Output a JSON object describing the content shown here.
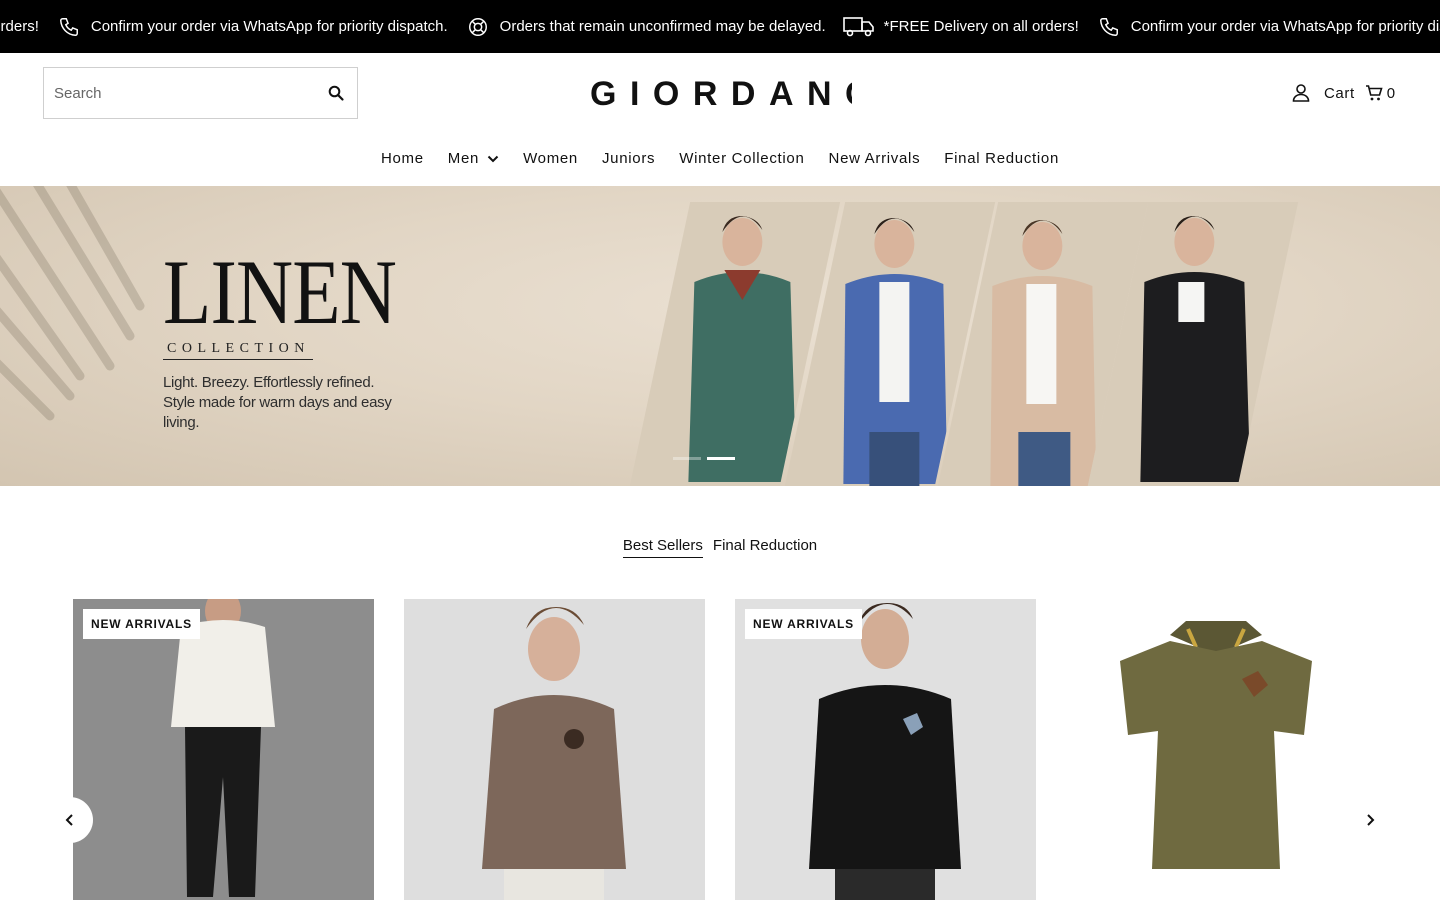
{
  "announcement": {
    "items": [
      {
        "icon": "truck-icon",
        "text": "*FREE Delivery on all orders!"
      },
      {
        "icon": "phone-icon",
        "text": "Confirm your order via WhatsApp for priority dispatch."
      },
      {
        "icon": "lifebuoy-icon",
        "text": "Orders that remain unconfirmed may be delayed."
      },
      {
        "icon": "truck-icon",
        "text": "*FREE Delivery on all orders!"
      },
      {
        "icon": "phone-icon",
        "text": "Confirm your order via WhatsApp for priority dispatch."
      }
    ],
    "first_fragment": "all orders!"
  },
  "header": {
    "search_placeholder": "Search",
    "logo_text": "GIORDANO",
    "cart_label": "Cart",
    "cart_count": "0"
  },
  "nav": {
    "items": [
      "Home",
      "Men",
      "Women",
      "Juniors",
      "Winter Collection",
      "New Arrivals",
      "Final Reduction"
    ]
  },
  "hero": {
    "title": "LINEN",
    "subtitle": "COLLECTION",
    "tagline": "Light. Breezy. Effortlessly refined. Style made for warm days and easy living.",
    "shirt_colors": [
      "#3f6e63",
      "#4a6ab0",
      "#d8bba3",
      "#1d1d1f"
    ],
    "slides": 2,
    "active_slide": 2
  },
  "collection_tabs": {
    "items": [
      "Best Sellers",
      "Final Reduction"
    ],
    "active": "Best Sellers"
  },
  "products": [
    {
      "badge": "NEW ARRIVALS",
      "shirt_color": "#f1efe9",
      "bg": "#8a8a8a"
    },
    {
      "badge": "",
      "shirt_color": "#7d675a",
      "bg": "#dcdcdc"
    },
    {
      "badge": "NEW ARRIVALS",
      "shirt_color": "#151515",
      "bg": "#dedede"
    },
    {
      "badge": "",
      "shirt_color": "#6f6a40",
      "bg": "#ffffff"
    }
  ]
}
